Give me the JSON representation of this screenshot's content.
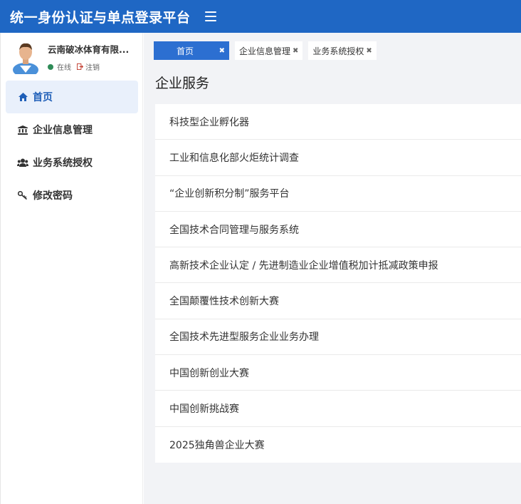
{
  "app": {
    "title": "统一身份认证与单点登录平台"
  },
  "user": {
    "name": "云南破冰体育有限...",
    "status": "在线",
    "logout": "注销"
  },
  "sidebar": {
    "items": [
      {
        "label": "首页",
        "icon": "home-icon"
      },
      {
        "label": "企业信息管理",
        "icon": "bank-icon"
      },
      {
        "label": "业务系统授权",
        "icon": "users-icon"
      },
      {
        "label": "修改密码",
        "icon": "key-icon"
      }
    ]
  },
  "tabs": [
    {
      "label": "首页",
      "close": "✖"
    },
    {
      "label": "企业信息管理",
      "close": "✖"
    },
    {
      "label": "业务系统授权",
      "close": "✖"
    }
  ],
  "main": {
    "title": "企业服务",
    "services": [
      "科技型企业孵化器",
      "工业和信息化部火炬统计调查",
      "“企业创新积分制”服务平台",
      "全国技术合同管理与服务系统",
      "高新技术企业认定 / 先进制造业企业增值税加计抵减政策申报",
      "全国颠覆性技术创新大赛",
      "全国技术先进型服务企业业务办理",
      "中国创新创业大赛",
      "中国创新挑战赛",
      "2025独角兽企业大赛"
    ]
  },
  "colors": {
    "topbar": "#1f67c4",
    "active_tab": "#2c6fd1",
    "active_nav_bg": "#e9f0fb",
    "online": "#2e8b57"
  }
}
